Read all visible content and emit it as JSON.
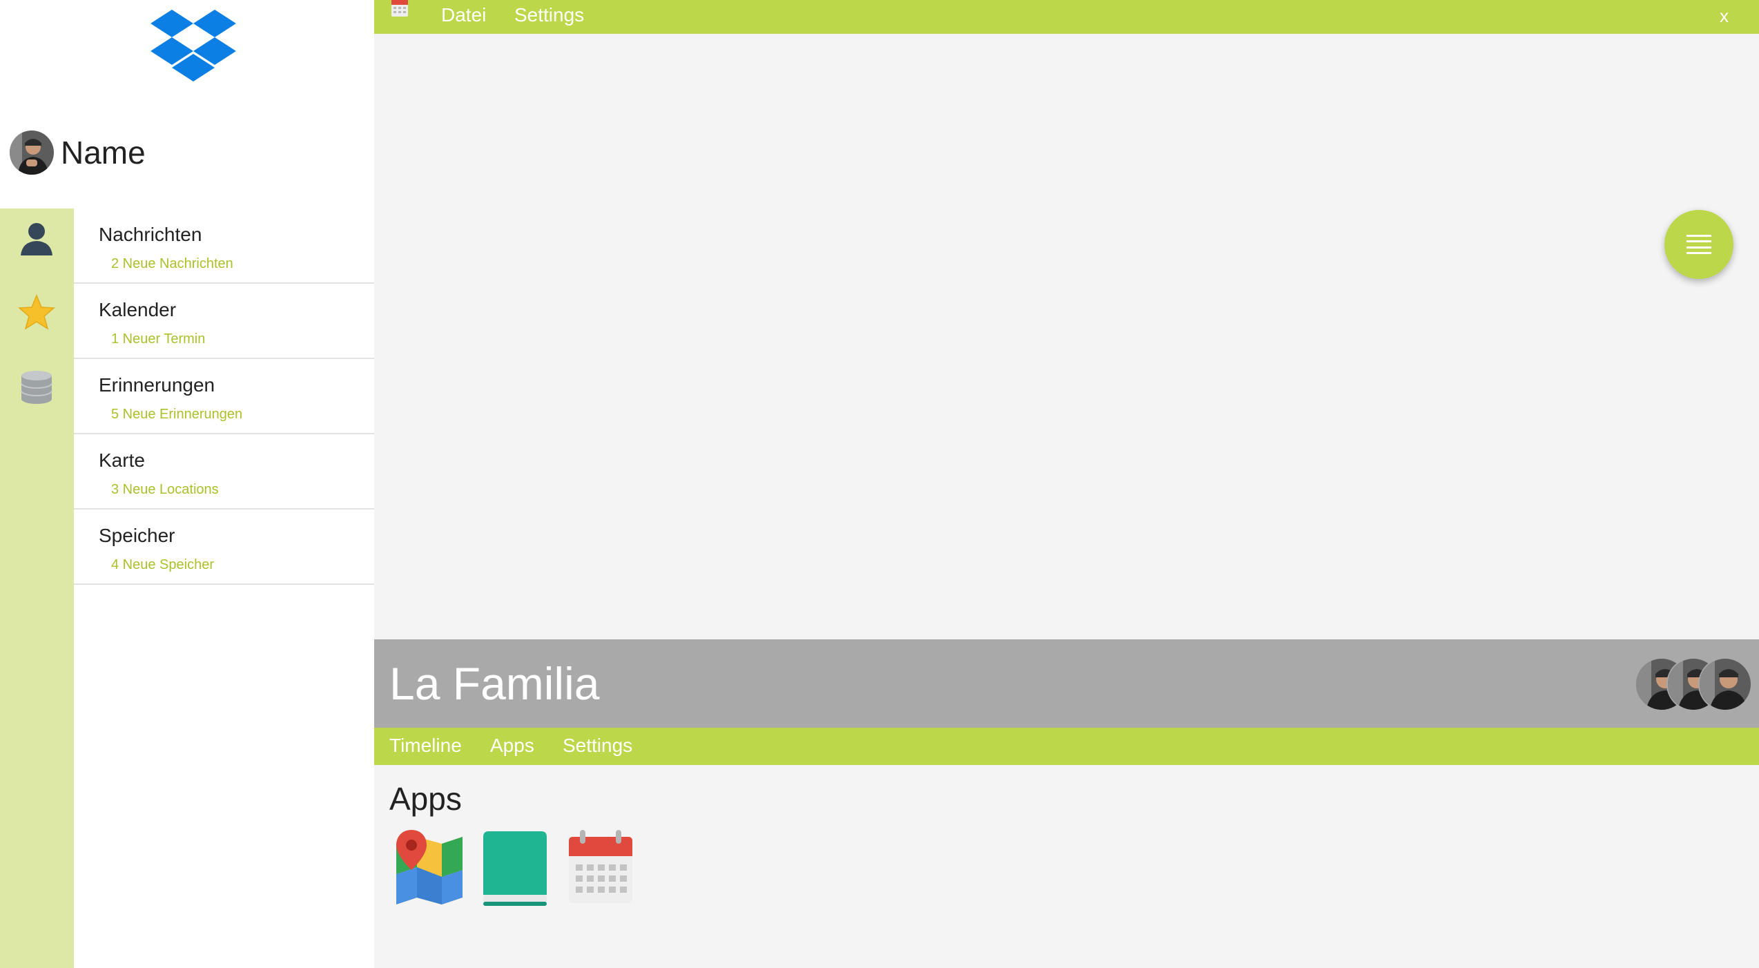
{
  "sidebar": {
    "logo_icon": "dropbox-logo-icon",
    "profile_name": "Name",
    "rail_icons": [
      "person-icon",
      "star-icon",
      "database-icon"
    ],
    "items": [
      {
        "title": "Nachrichten",
        "subtitle": "2 Neue Nachrichten"
      },
      {
        "title": "Kalender",
        "subtitle": "1 Neuer Termin"
      },
      {
        "title": "Erinnerungen",
        "subtitle": "5 Neue Erinnerungen"
      },
      {
        "title": "Karte",
        "subtitle": "3 Neue Locations"
      },
      {
        "title": "Speicher",
        "subtitle": "4 Neue Speicher"
      }
    ]
  },
  "topbar": {
    "menu": [
      "Datei",
      "Settings"
    ],
    "close_label": "x"
  },
  "fab": {
    "icon": "menu-lines-icon"
  },
  "group": {
    "title": "La Familia",
    "member_count": 3
  },
  "tabs": [
    "Timeline",
    "Apps",
    "Settings"
  ],
  "apps": {
    "title": "Apps",
    "icons": [
      "map-icon",
      "book-icon",
      "calendar-icon"
    ]
  },
  "colors": {
    "accent": "#bdd74a",
    "accent_text": "#a8c22a",
    "rail": "#dde8a6",
    "header_gray": "#a9a9a9",
    "background": "#f4f4f4"
  }
}
